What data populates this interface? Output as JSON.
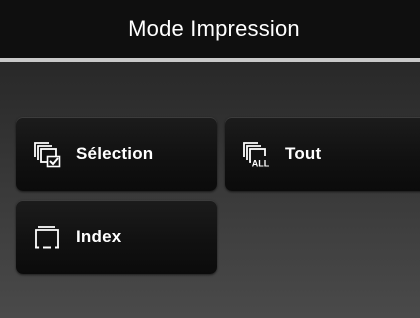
{
  "header": {
    "title": "Mode Impression"
  },
  "menu": {
    "items": [
      {
        "label": "Sélection",
        "icon": "select-images-icon"
      },
      {
        "label": "Tout",
        "icon": "all-images-icon",
        "icon_text": "ALL"
      },
      {
        "label": "Index",
        "icon": "index-print-icon"
      }
    ]
  },
  "colors": {
    "title_bar": "#0f0f0f",
    "separator": "#c9c9c9",
    "button": "#131313",
    "text": "#ffffff"
  }
}
